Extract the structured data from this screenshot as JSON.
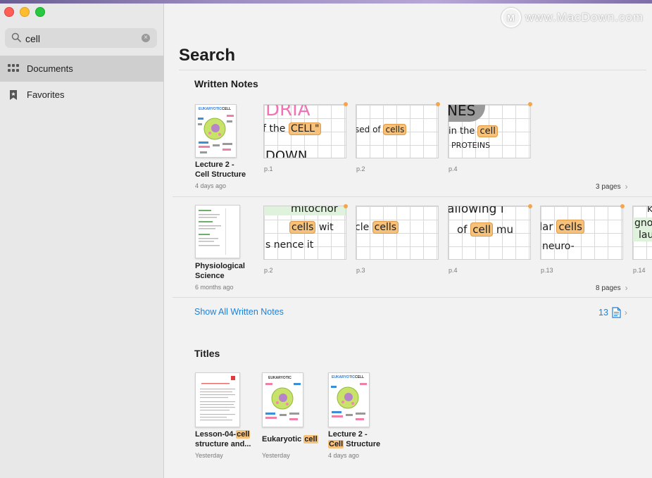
{
  "search": {
    "query": "cell",
    "clear_glyph": "×"
  },
  "sidebar": {
    "items": [
      {
        "label": "Documents",
        "icon": "grid-icon",
        "active": true
      },
      {
        "label": "Favorites",
        "icon": "bookmark-star-icon",
        "active": false
      }
    ]
  },
  "watermark": {
    "logo": "M",
    "text": "www.MacDown.com"
  },
  "main": {
    "title": "Search",
    "written_notes": {
      "heading": "Written Notes",
      "documents": [
        {
          "title_line1": "Lecture 2 -",
          "title_line2": "Cell Structure",
          "date": "4 days ago",
          "pages_label": "3 pages",
          "matches": [
            {
              "page": "p.1",
              "top": "DRIA",
              "mid_prefix": "f the",
              "mid_hl": "CELL\"",
              "bottom": "DOWN"
            },
            {
              "page": "p.2",
              "mid_prefix": "sed of",
              "mid_hl": "cells"
            },
            {
              "page": "p.4",
              "top": "NES",
              "mid_prefix": "in the",
              "mid_hl": "cell",
              "bottom": "PROTEINS"
            }
          ]
        },
        {
          "title_line1": "Physiological",
          "title_line2": "Science",
          "date": "6 months ago",
          "pages_label": "8 pages",
          "matches": [
            {
              "page": "p.2",
              "top": "mitochor",
              "mid_hl": "cells",
              "mid_suffix": "wit",
              "bottom": "s   nence it"
            },
            {
              "page": "p.3",
              "mid_prefix": "cle",
              "mid_hl": "cells"
            },
            {
              "page": "p.4",
              "top": "allowing i",
              "mid_prefix": "of",
              "mid_hl": "cell",
              "mid_suffix": "mu"
            },
            {
              "page": "p.13",
              "mid_prefix": "lar",
              "mid_hl": "cells",
              "bottom": "neuro-"
            },
            {
              "page": "p.14",
              "top": "k",
              "mid_prefix": "gno",
              "bottom": "lau"
            }
          ]
        }
      ],
      "show_all_label": "Show All Written Notes",
      "show_all_count": "13"
    },
    "titles": {
      "heading": "Titles",
      "items": [
        {
          "line1_prefix": "Lesson-04-",
          "line1_hl": "cell",
          "line2": "structure and...",
          "date": "Yesterday"
        },
        {
          "line1_prefix": "Eukaryotic ",
          "line1_hl": "cell",
          "line2": "",
          "date": "Yesterday"
        },
        {
          "line1_prefix": "Lecture 2 -",
          "line1_hl": "",
          "line2_hl": "Cell",
          "line2": " Structure",
          "date": "4 days ago"
        }
      ]
    },
    "thumb_text": {
      "eukaryotic": "EUKARYOTIC",
      "cell": "CELL"
    }
  },
  "colors": {
    "accent": "#1f7fd6",
    "highlight": "#f6c27b",
    "badge_dot": "#f5a54a"
  }
}
